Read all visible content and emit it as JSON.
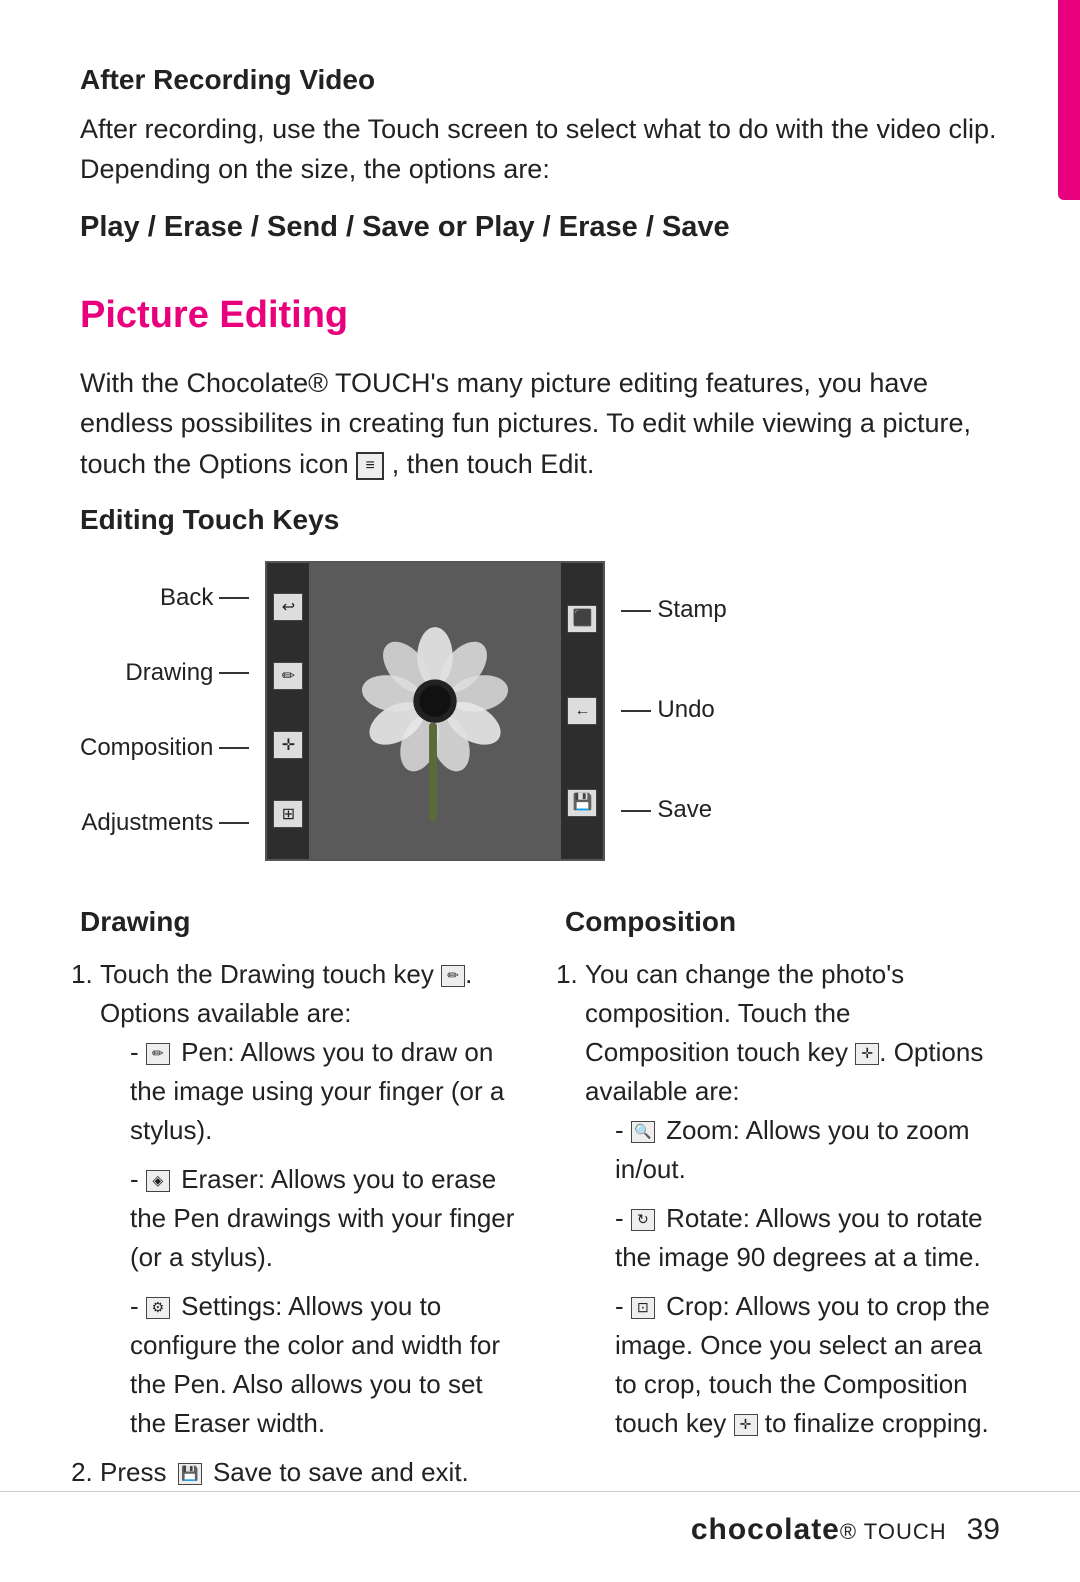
{
  "accent_bar": {},
  "section1": {
    "heading": "After Recording Video",
    "body": "After recording, use the Touch screen to select what to do with the video clip. Depending on the size, the options are:",
    "options_line": "Play / Erase / Send / Save or Play / Erase / Save"
  },
  "section2": {
    "heading": "Picture Editing",
    "intro": "With the Chocolate® TOUCH's many picture editing features, you have endless possibilites in creating fun pictures. To edit while viewing a picture, touch the Options icon",
    "intro_end": ", then touch Edit.",
    "edit_word": "Edit"
  },
  "diagram": {
    "heading": "Editing Touch Keys",
    "left_labels": [
      "Back",
      "Drawing",
      "Composition",
      "Adjustments"
    ],
    "right_labels": [
      "Stamp",
      "Undo",
      "Save"
    ]
  },
  "drawing": {
    "heading": "Drawing",
    "step1": "Touch the Drawing touch key",
    "step1_suffix": ". Options available are:",
    "bullets": [
      "Pen: Allows you to draw on the image using your finger (or a stylus).",
      "Eraser: Allows you to erase the Pen drawings with your finger (or a stylus).",
      "Settings: Allows you to configure the color and width for the Pen. Also allows you to set the Eraser width."
    ],
    "step2_prefix": "Press",
    "step2_suffix": "Save to save and exit."
  },
  "composition": {
    "heading": "Composition",
    "step1": "You can change the photo's composition. Touch the Composition touch key",
    "step1_suffix": ". Options available are:",
    "bullets": [
      "Zoom: Allows you to zoom in/out.",
      "Rotate: Allows you to rotate the image 90 degrees at a time.",
      "Crop: Allows you to crop the image. Once you select an area to crop, touch the Composition touch key"
    ],
    "bullet3_suffix": " to finalize cropping."
  },
  "footer": {
    "brand": "chocolate",
    "touch": "® TOUCH",
    "page": "39"
  }
}
